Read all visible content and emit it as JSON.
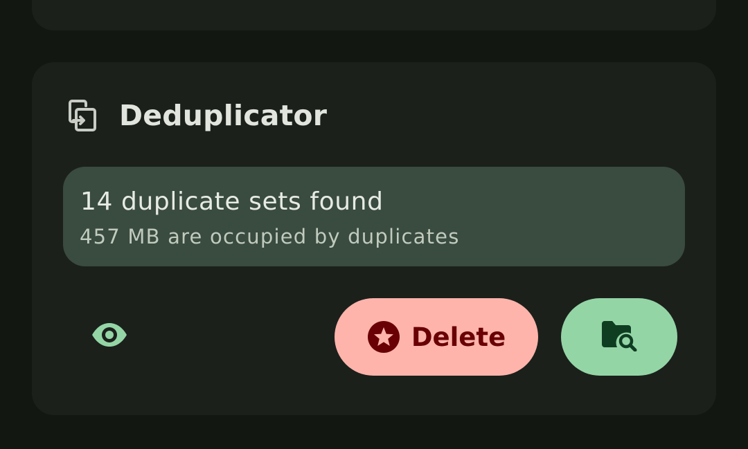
{
  "colors": {
    "background": "#121712",
    "card": "#1b201b",
    "info_box": "#3a4b3f",
    "delete_button": "#ffb4ab",
    "delete_text": "#690005",
    "browse_button": "#94d5a5",
    "accent_green": "#94d5a5"
  },
  "deduplicator": {
    "title": "Deduplicator",
    "icon": "duplicate-copy-icon",
    "summary": {
      "primary": "14 duplicate sets found",
      "secondary": "457 MB are occupied by duplicates"
    },
    "actions": {
      "preview_icon": "eye-icon",
      "delete_label": "Delete",
      "delete_icon": "star-badge-icon",
      "browse_icon": "folder-search-icon"
    }
  }
}
